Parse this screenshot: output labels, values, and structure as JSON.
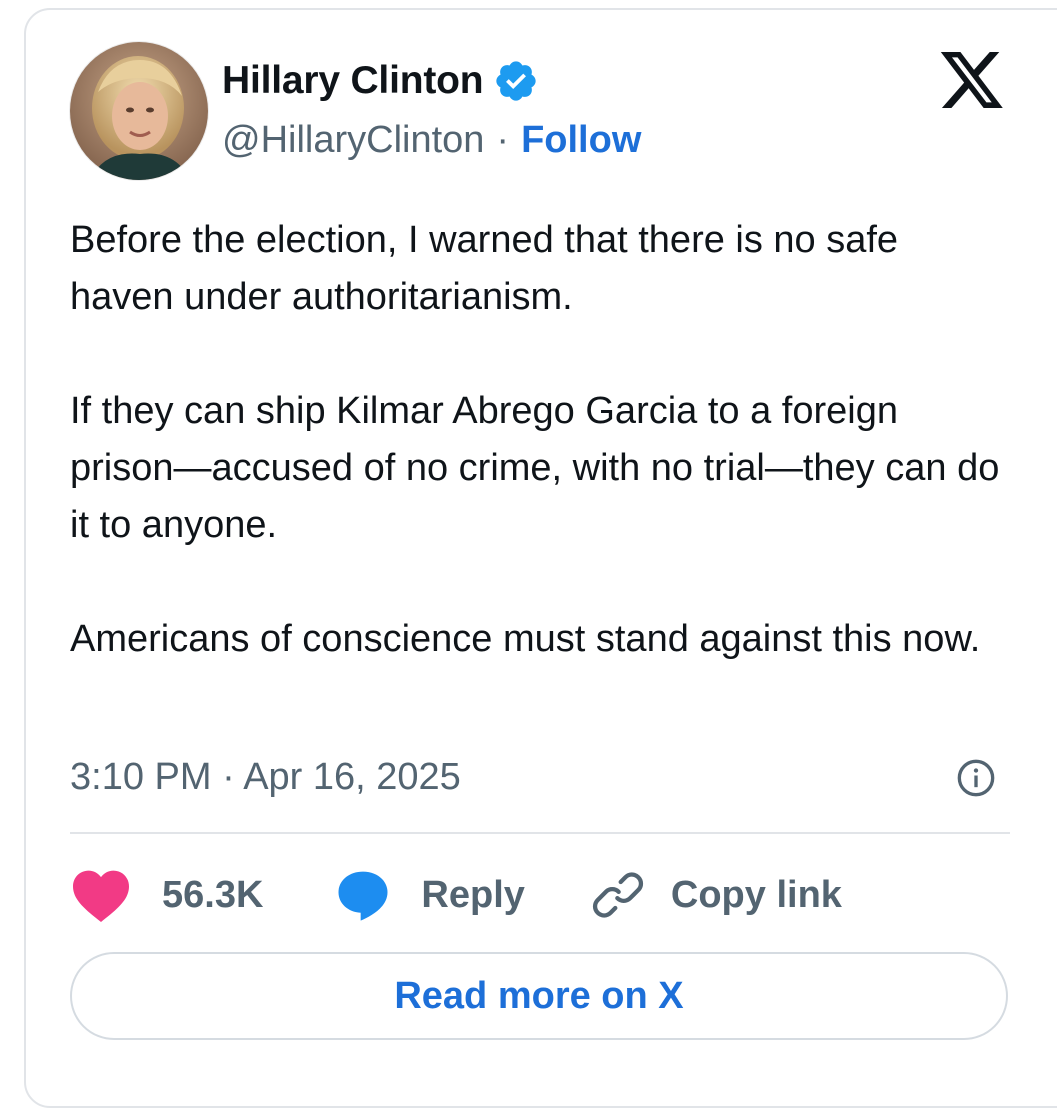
{
  "author": {
    "name": "Hillary Clinton",
    "handle": "@HillaryClinton",
    "separator": "·",
    "follow_label": "Follow",
    "verified": true
  },
  "icons": {
    "verified": "verified-badge-icon",
    "brand": "x-logo-icon",
    "info": "info-icon",
    "like": "heart-icon",
    "reply": "speech-bubble-icon",
    "copy_link": "link-icon"
  },
  "tweet": {
    "paragraphs": [
      "Before the election, I warned that there is no safe haven under authoritarianism.",
      "If they can ship Kilmar Abrego Garcia to a foreign prison—accused of no crime, with no trial—they can do it to anyone.",
      "Americans of conscience must stand against this now."
    ],
    "timestamp": "3:10 PM · Apr 16, 2025"
  },
  "actions": {
    "likes": "56.3K",
    "reply_label": "Reply",
    "copy_link_label": "Copy link"
  },
  "read_more_label": "Read more on X",
  "colors": {
    "link_blue": "#1d6fd8",
    "verified_blue": "#1d9bf0",
    "heart_pink": "#f23a85",
    "muted_gray": "#536471",
    "reply_blue": "#1d8df0"
  }
}
